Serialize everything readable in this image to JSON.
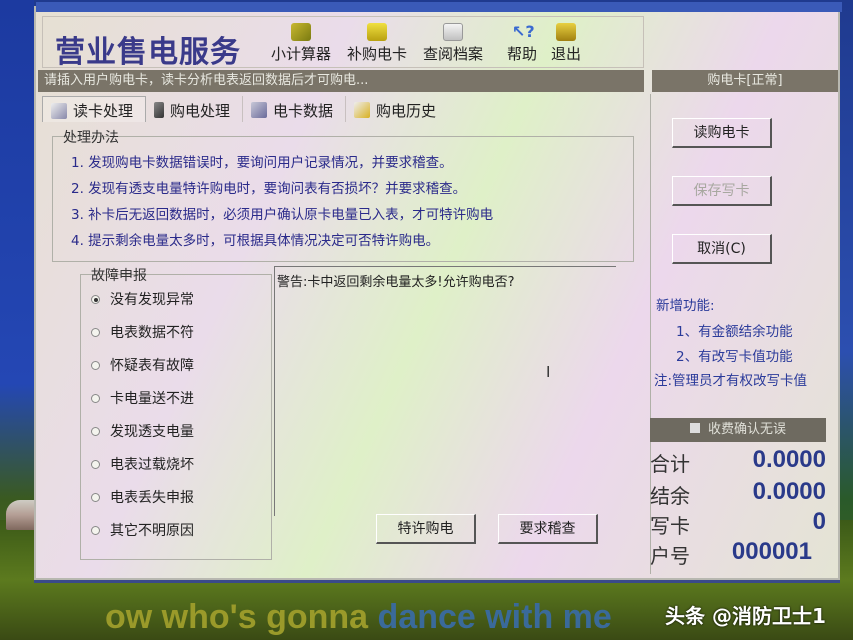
{
  "window": {
    "title": "营业售电服务",
    "toolbar": [
      {
        "label": "小计算器",
        "icon": "calculator-icon"
      },
      {
        "label": "补购电卡",
        "icon": "card-folder-icon"
      },
      {
        "label": "查阅档案",
        "icon": "search-document-icon"
      },
      {
        "label": "帮助",
        "icon": "help-icon"
      },
      {
        "label": "退出",
        "icon": "exit-icon"
      }
    ],
    "status_message": "请插入用户购电卡，读卡分析电表返回数据后才可购电...",
    "right_status": "购电卡[正常]"
  },
  "tabs": [
    {
      "label": "读卡处理",
      "icon": "read-card-icon",
      "active": true
    },
    {
      "label": "购电处理",
      "icon": "purchase-icon",
      "active": false
    },
    {
      "label": "电卡数据",
      "icon": "card-data-icon",
      "active": false
    },
    {
      "label": "购电历史",
      "icon": "history-icon",
      "active": false
    }
  ],
  "methods": {
    "legend": "处理办法",
    "items": [
      "1. 发现购电卡数据错误时，要询问用户记录情况，并要求稽查。",
      "2. 发现有透支电量特许购电时，要询问表有否损坏？并要求稽查。",
      "3. 补卡后无返回数据时，必须用户确认原卡电量已入表，才可特许购电",
      "4. 提示剩余电量太多时，可根据具体情况决定可否特许购电。"
    ]
  },
  "faults": {
    "legend": "故障申报",
    "selected": 0,
    "options": [
      "没有发现异常",
      "电表数据不符",
      "怀疑表有故障",
      "卡电量送不进",
      "发现透支电量",
      "电表过载烧坏",
      "电表丢失申报",
      "其它不明原因"
    ]
  },
  "warning": {
    "text": "警告:卡中返回剩余电量太多!允许购电否?"
  },
  "actions": {
    "allow_label": "特许购电",
    "audit_label": "要求稽查"
  },
  "right_panel": {
    "read_label": "读购电卡",
    "save_label": "保存写卡",
    "cancel_label": "取消(C)",
    "new_features_title": "新增功能:",
    "new_features": [
      "1、有金额结余功能",
      "2、有改写卡值功能"
    ],
    "note": "注:管理员才有权改写卡值",
    "summary_title": "收费确认无误",
    "summary": [
      {
        "label": "合计",
        "value": "0.0000"
      },
      {
        "label": "结余",
        "value": "0.0000"
      },
      {
        "label": "写卡",
        "value": "0"
      },
      {
        "label": "户号",
        "value": "000001"
      }
    ]
  },
  "background": {
    "lyric_a": "ow who's gonna ",
    "lyric_b": "dance with me",
    "watermark": "头条 @消防卫士1"
  }
}
